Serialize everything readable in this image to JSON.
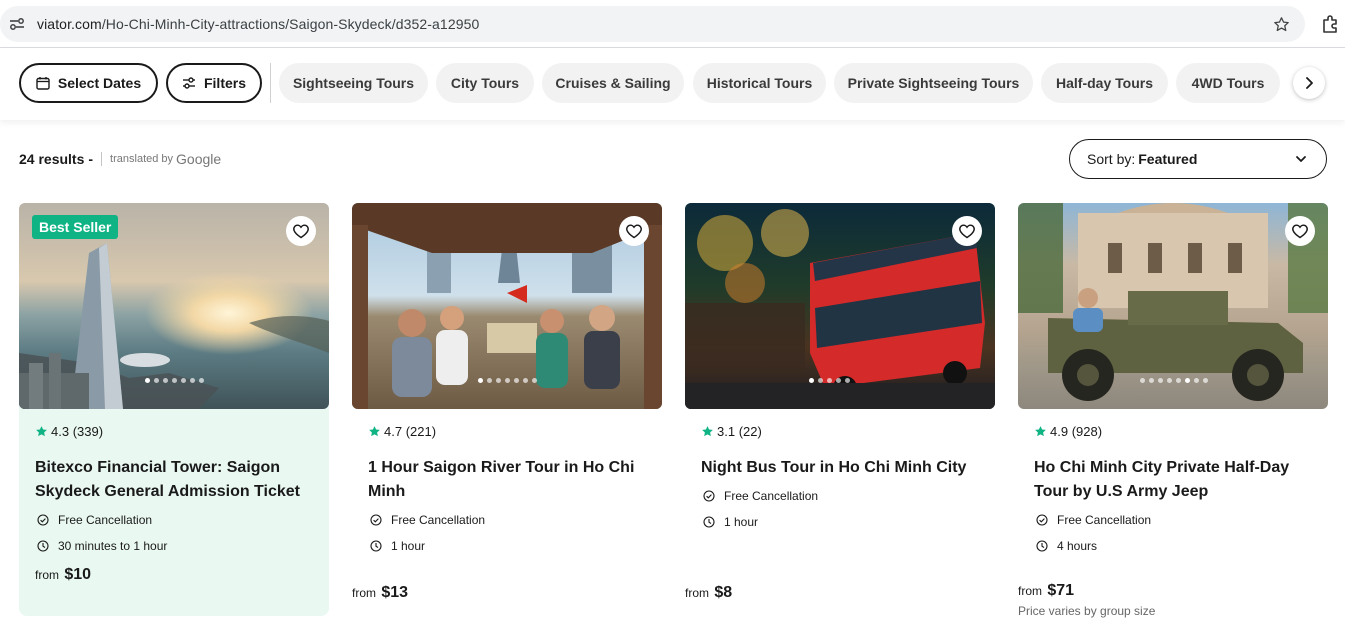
{
  "browser": {
    "url_host": "viator.com",
    "url_path": "/Ho-Chi-Minh-City-attractions/Saigon-Skydeck/d352-a12950",
    "icons": [
      "site-info-icon",
      "bookmark-star-icon",
      "extensions-icon"
    ]
  },
  "filters": {
    "select_dates": "Select Dates",
    "filters": "Filters",
    "categories": [
      "Sightseeing Tours",
      "City Tours",
      "Cruises & Sailing",
      "Historical Tours",
      "Private Sightseeing Tours",
      "Half-day Tours",
      "4WD Tours"
    ]
  },
  "results": {
    "count": "24 results",
    "dash": "-",
    "translated_by": "translated by",
    "google": "Google"
  },
  "sort": {
    "label": "Sort by:",
    "value": "Featured"
  },
  "cards": [
    {
      "badge": "Best Seller",
      "rating": "4.3",
      "reviews": "(339)",
      "title": "Bitexco Financial Tower: Saigon Skydeck General Admission Ticket",
      "cancellation": "Free Cancellation",
      "duration": "30 minutes to 1 hour",
      "price_prefix": "from",
      "price": "$10",
      "price_note": ""
    },
    {
      "badge": "",
      "rating": "4.7",
      "reviews": "(221)",
      "title": "1 Hour Saigon River Tour in Ho Chi Minh",
      "cancellation": "Free Cancellation",
      "duration": "1 hour",
      "price_prefix": "from",
      "price": "$13",
      "price_note": ""
    },
    {
      "badge": "",
      "rating": "3.1",
      "reviews": "(22)",
      "title": "Night Bus Tour in Ho Chi Minh City",
      "cancellation": "Free Cancellation",
      "duration": "1 hour",
      "price_prefix": "from",
      "price": "$8",
      "price_note": ""
    },
    {
      "badge": "",
      "rating": "4.9",
      "reviews": "(928)",
      "title": "Ho Chi Minh City Private Half-Day Tour by U.S Army Jeep",
      "cancellation": "Free Cancellation",
      "duration": "4 hours",
      "price_prefix": "from",
      "price": "$71",
      "price_note": "Price varies by group size"
    }
  ],
  "colors": {
    "accent_green": "#10b384",
    "featured_bg": "#e9f8f1",
    "pill_bg": "#f2f2f2"
  }
}
